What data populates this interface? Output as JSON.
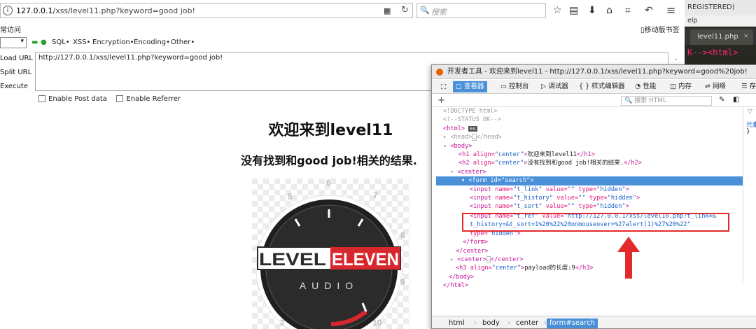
{
  "browser": {
    "url": "127.0.0.1/xss/level11.php?keyword=good job!",
    "url_host": "127.0.0.1",
    "url_path": "/xss/level11.php?keyword=good job!",
    "search_placeholder": "搜索",
    "bookmarks_left": "常访问",
    "bookmarks_right": "移动版书签"
  },
  "hackbar": {
    "menu": [
      "SQL•",
      "XSS•",
      "Encryption•",
      "Encoding•",
      "Other•"
    ],
    "load_url": "Load URL",
    "split_url": "Split URL",
    "execute": "Execute",
    "url_value": "http://127.0.0.1/xss/level11.php?keyword=good job!",
    "enable_post": "Enable Post data",
    "enable_referrer": "Enable Referrer"
  },
  "page": {
    "title": "欢迎来到level11",
    "subtitle": "没有找到和good job!相关的结果.",
    "logo_top": "LEVELELEVEN",
    "logo_left": "LEVEL",
    "logo_right": "ELEVEN",
    "logo_bottom": "AUDIO",
    "dial_numbers": [
      "5",
      "6",
      "7",
      "8",
      "9",
      "10",
      "2"
    ]
  },
  "sublime": {
    "title": "REGISTERED)",
    "menu": "elp",
    "tab": "level11.php",
    "tab_close": "×",
    "code": "K--><html>"
  },
  "devtools": {
    "title": "开发者工具 - 欢迎来到level11 - http://127.0.0.1/xss/level11.php?keyword=good%20job!",
    "tabs": [
      "查看器",
      "控制台",
      "调试器",
      "{ } 样式编辑器",
      "性能",
      "内存",
      "网络",
      "存"
    ],
    "search_placeholder": "搜索 HTML",
    "side_text": "元素",
    "side_brace": "}",
    "lines": [
      {
        "t": "<!DOCTYPE html>",
        "c": "dim"
      },
      {
        "t": "<!--STATUS OK-->",
        "c": "dim"
      },
      {
        "t": "<html>",
        "c": "tag"
      },
      {
        "t": "<head>",
        "c": "dim"
      },
      {
        "t": "<body>",
        "c": "tag"
      },
      {
        "t": "欢迎来到level11",
        "c": "text"
      },
      {
        "t": "没有找到和good job!相关的结果.",
        "c": "text"
      },
      {
        "t": "<center>",
        "c": "tag"
      },
      {
        "t": "<form id=\"search\">",
        "c": "hl"
      },
      {
        "t": "t_link",
        "c": "attr"
      },
      {
        "t": "t_history",
        "c": "attr"
      },
      {
        "t": "t_sort",
        "c": "attr"
      },
      {
        "t": "t_ref",
        "c": "attr"
      },
      {
        "t": "http://127.0.0.1/xss/level10.php?t_link=&",
        "c": "val"
      },
      {
        "t": "t_history=&t_sort=1%20%22%20onmouseover=%27alert(1)%27%20%22",
        "c": "val"
      },
      {
        "t": "hidden",
        "c": "val"
      },
      {
        "t": "</form>",
        "c": "tag"
      },
      {
        "t": "</center>",
        "c": "tag"
      },
      {
        "t": "<center>",
        "c": "tag"
      },
      {
        "t": "payload的长度:9",
        "c": "text"
      },
      {
        "t": "</body>",
        "c": "tag"
      },
      {
        "t": "</html>",
        "c": "tag"
      }
    ],
    "breadcrumbs": [
      "html",
      "body",
      "center",
      "form#search"
    ]
  }
}
